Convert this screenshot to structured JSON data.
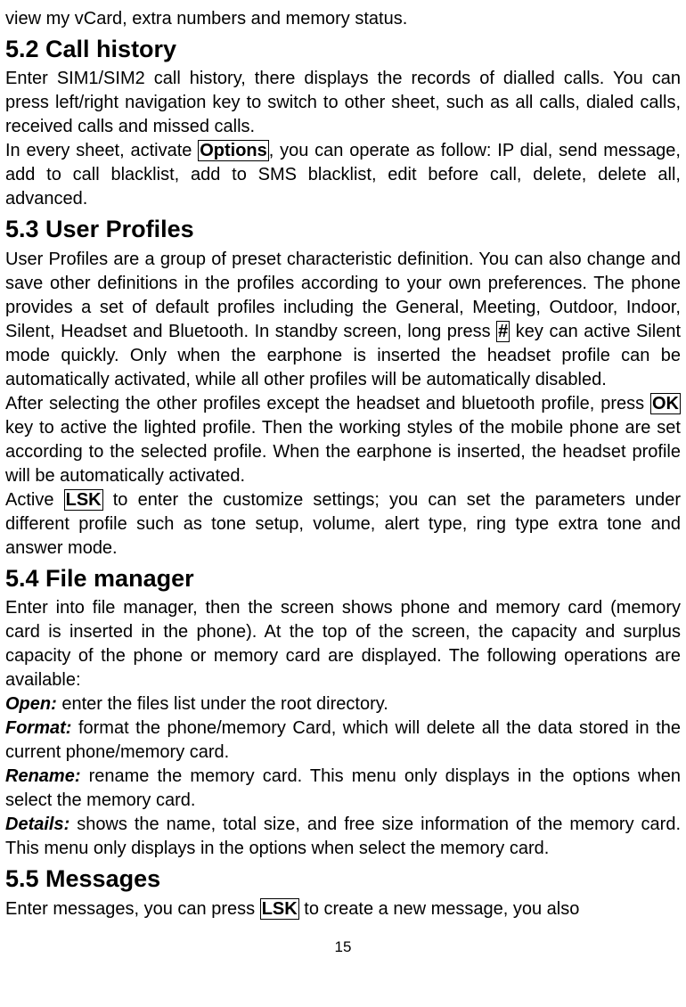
{
  "intro": "view my vCard, extra numbers and memory status.",
  "sections": {
    "s52": {
      "heading": "5.2  Call history",
      "p1a": "Enter SIM1/SIM2 call history, there displays the records of dialled calls. You can press left/right navigation key to switch to other sheet, such as all calls, dialed calls, received calls and missed calls.",
      "p2_before": "In every sheet, activate ",
      "p2_options": "Options",
      "p2_after": ", you can operate as follow: IP dial, send message, add to call blacklist, add to SMS blacklist, edit before call, delete, delete all, advanced."
    },
    "s53": {
      "heading": "5.3  User Profiles",
      "p1_before": "User Profiles are a group of preset characteristic definition. You can also change and save other definitions in the profiles according to your own preferences. The phone provides a set of default profiles including the General, Meeting, Outdoor, Indoor, Silent, Headset and Bluetooth. In standby screen, long press ",
      "p1_key": "#",
      "p1_after": " key can active Silent mode quickly. Only when the earphone is inserted the headset profile can be automatically activated, while all other profiles will be automatically disabled.",
      "p2_before": "After selecting the other profiles except the headset and bluetooth profile, press ",
      "p2_key": "OK",
      "p2_after": " key to active the lighted profile. Then the working styles of the mobile phone are set according to the selected profile. When the earphone is inserted, the headset profile will be automatically activated.",
      "p3_before": "Active ",
      "p3_key": "LSK",
      "p3_after": " to enter the customize settings; you can set the parameters under different profile such as tone setup, volume, alert type, ring type extra tone and answer mode."
    },
    "s54": {
      "heading": "5.4  File manager",
      "p1": "Enter into file manager, then the screen shows phone and memory card (memory card is inserted in the phone). At the top of the screen, the capacity and surplus capacity of the phone or memory card are displayed. The following operations are available:",
      "open_label": "Open:",
      "open_text": " enter the files list under the root directory.",
      "format_label": "Format:",
      "format_text": " format the phone/memory Card, which will delete all the data stored in the current phone/memory card.",
      "rename_label": "Rename:",
      "rename_text": " rename the memory card. This menu only displays in the options when select the memory card.",
      "details_label": "Details:",
      "details_text": " shows the name, total size, and free size information of the memory card. This menu only displays in the options when select the memory card."
    },
    "s55": {
      "heading": "5.5  Messages",
      "p1_before": "Enter messages, you can press ",
      "p1_key": "LSK",
      "p1_after": " to create a new message, you also"
    }
  },
  "page_number": "15"
}
